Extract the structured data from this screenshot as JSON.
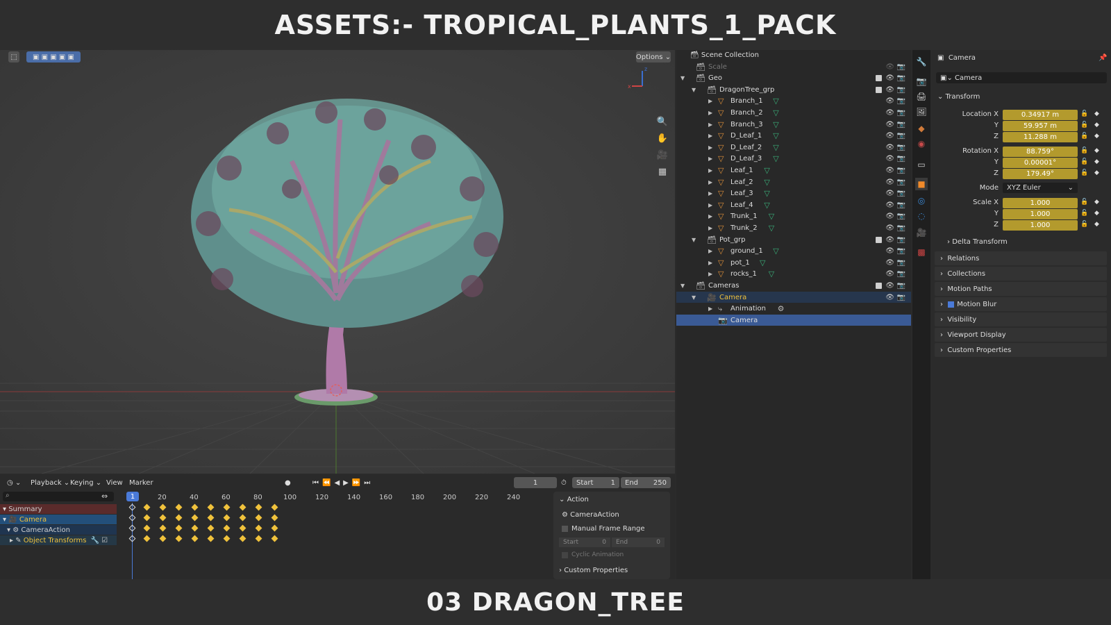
{
  "banner": {
    "top": "ASSETS:- TROPICAL_PLANTS_1_PACK",
    "bottom": "03 DRAGON_TREE"
  },
  "viewport": {
    "options_label": "Options"
  },
  "timeline": {
    "menus": [
      "Playback",
      "Keying",
      "View",
      "Marker"
    ],
    "current_frame": "1",
    "start_label": "Start",
    "start_value": "1",
    "end_label": "End",
    "end_value": "250",
    "ticks": [
      "1",
      "20",
      "40",
      "60",
      "80",
      "100",
      "120",
      "140",
      "160",
      "180",
      "200",
      "220",
      "240"
    ],
    "channels": [
      {
        "label": "Summary",
        "color": "#ddd"
      },
      {
        "label": "Camera",
        "color": "#f0c23c"
      },
      {
        "label": "CameraAction",
        "color": "#ddd"
      },
      {
        "label": "Object Transforms",
        "color": "#f0c23c"
      }
    ],
    "action_panel": {
      "header": "Action",
      "action_name": "CameraAction",
      "manual_range": "Manual Frame Range",
      "start_label": "Start",
      "start_value": "0",
      "end_label": "End",
      "end_value": "0",
      "cyclic": "Cyclic Animation",
      "custom_props": "Custom Properties"
    }
  },
  "outliner": {
    "title": "Scene Collection",
    "rows": [
      {
        "label": "Scale",
        "indent": 0,
        "dim": true,
        "type": "collection"
      },
      {
        "label": "Geo",
        "indent": 0,
        "type": "collection",
        "arrow": "open",
        "checkbox": true
      },
      {
        "label": "DragonTree_grp",
        "indent": 1,
        "type": "collection",
        "arrow": "open",
        "checkbox": true
      },
      {
        "label": "Branch_1",
        "indent": 2,
        "type": "mesh"
      },
      {
        "label": "Branch_2",
        "indent": 2,
        "type": "mesh"
      },
      {
        "label": "Branch_3",
        "indent": 2,
        "type": "mesh"
      },
      {
        "label": "D_Leaf_1",
        "indent": 2,
        "type": "mesh"
      },
      {
        "label": "D_Leaf_2",
        "indent": 2,
        "type": "mesh"
      },
      {
        "label": "D_Leaf_3",
        "indent": 2,
        "type": "mesh"
      },
      {
        "label": "Leaf_1",
        "indent": 2,
        "type": "mesh"
      },
      {
        "label": "Leaf_2",
        "indent": 2,
        "type": "mesh"
      },
      {
        "label": "Leaf_3",
        "indent": 2,
        "type": "mesh"
      },
      {
        "label": "Leaf_4",
        "indent": 2,
        "type": "mesh"
      },
      {
        "label": "Trunk_1",
        "indent": 2,
        "type": "mesh"
      },
      {
        "label": "Trunk_2",
        "indent": 2,
        "type": "mesh"
      },
      {
        "label": "Pot_grp",
        "indent": 1,
        "type": "collection",
        "arrow": "open",
        "checkbox": true
      },
      {
        "label": "ground_1",
        "indent": 2,
        "type": "mesh"
      },
      {
        "label": "pot_1",
        "indent": 2,
        "type": "mesh"
      },
      {
        "label": "rocks_1",
        "indent": 2,
        "type": "mesh"
      },
      {
        "label": "Cameras",
        "indent": 0,
        "type": "collection",
        "arrow": "open",
        "checkbox": true
      },
      {
        "label": "Camera",
        "indent": 1,
        "type": "camera",
        "arrow": "open",
        "highlight": "light"
      },
      {
        "label": "Animation",
        "indent": 2,
        "type": "anim"
      },
      {
        "label": "Camera",
        "indent": 2,
        "type": "cameradata",
        "highlight": "strong"
      }
    ]
  },
  "properties": {
    "header": "Camera",
    "object_name": "Camera",
    "transform_label": "Transform",
    "location": {
      "label": "Location X",
      "x": "0.34917 m",
      "y": "59.957 m",
      "z": "11.288 m"
    },
    "rotation": {
      "label": "Rotation X",
      "x": "88.759°",
      "y": "0.00001°",
      "z": "179.49°"
    },
    "mode_label": "Mode",
    "mode_value": "XYZ Euler",
    "scale": {
      "label": "Scale X",
      "x": "1.000",
      "y": "1.000",
      "z": "1.000"
    },
    "axis_y": "Y",
    "axis_z": "Z",
    "delta": "Delta Transform",
    "sections": [
      "Relations",
      "Collections",
      "Motion Paths",
      "Motion Blur",
      "Visibility",
      "Viewport Display",
      "Custom Properties"
    ]
  }
}
